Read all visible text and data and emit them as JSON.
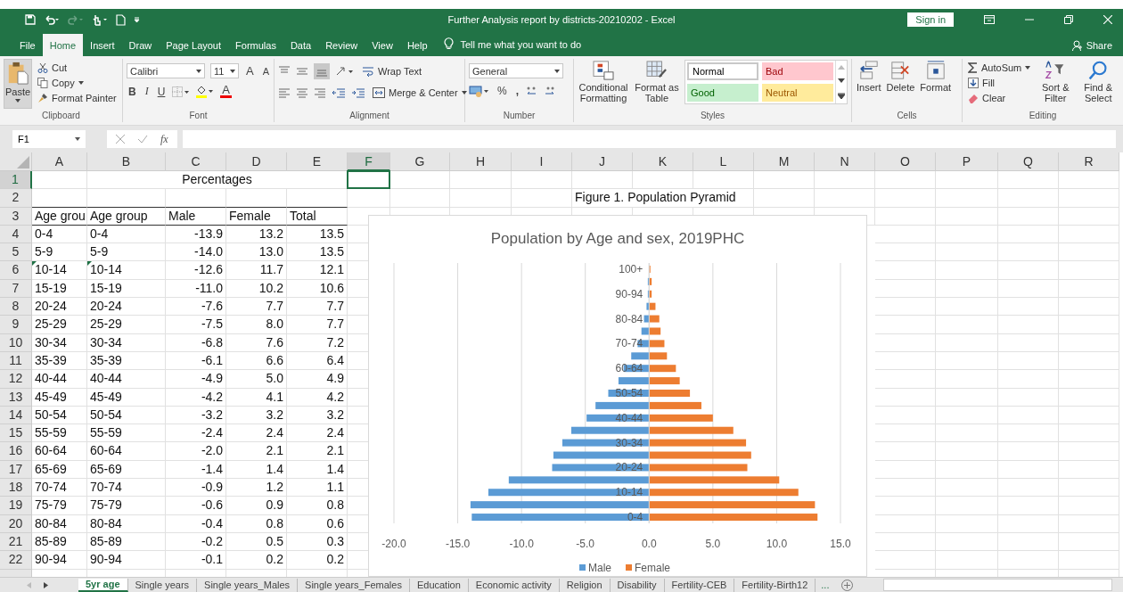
{
  "window": {
    "title": "Further Analysis report by districts-20210202 - Excel",
    "sign_in": "Sign in"
  },
  "menu_tabs": [
    {
      "label": "File",
      "selected": false
    },
    {
      "label": "Home",
      "selected": true
    },
    {
      "label": "Insert",
      "selected": false
    },
    {
      "label": "Draw",
      "selected": false
    },
    {
      "label": "Page Layout",
      "selected": false
    },
    {
      "label": "Formulas",
      "selected": false
    },
    {
      "label": "Data",
      "selected": false
    },
    {
      "label": "Review",
      "selected": false
    },
    {
      "label": "View",
      "selected": false
    },
    {
      "label": "Help",
      "selected": false
    }
  ],
  "tell_me": "Tell me what you want to do",
  "share": "Share",
  "ribbon": {
    "clipboard": {
      "paste": "Paste",
      "cut": "Cut",
      "copy": "Copy",
      "format_painter": "Format Painter",
      "label": "Clipboard"
    },
    "font": {
      "name": "Calibri",
      "size": "11",
      "grow": "A",
      "shrink": "A",
      "bold": "B",
      "italic": "I",
      "underline": "U",
      "font_color": "A",
      "label": "Font"
    },
    "alignment": {
      "wrap": "Wrap Text",
      "merge": "Merge & Center",
      "label": "Alignment"
    },
    "number": {
      "format": "General",
      "percent": "%",
      "comma": ",",
      "label": "Number"
    },
    "styles": {
      "conditional": "Conditional Formatting",
      "format_table": "Format as Table",
      "gallery": [
        {
          "label": "Normal",
          "kind": "normal"
        },
        {
          "label": "Bad",
          "kind": "bad"
        },
        {
          "label": "Good",
          "kind": "good"
        },
        {
          "label": "Neutral",
          "kind": "neutral"
        }
      ],
      "label": "Styles"
    },
    "cells": {
      "insert": "Insert",
      "delete": "Delete",
      "format": "Format",
      "label": "Cells"
    },
    "editing": {
      "autosum": "AutoSum",
      "fill": "Fill",
      "clear": "Clear",
      "sort": "Sort & Filter",
      "find": "Find & Select",
      "label": "Editing"
    }
  },
  "formula_bar": {
    "name_box": "F1",
    "fx": "fx"
  },
  "sheet": {
    "columns": [
      {
        "label": "A",
        "selected": false
      },
      {
        "label": "B",
        "selected": false
      },
      {
        "label": "C",
        "selected": false
      },
      {
        "label": "D",
        "selected": false
      },
      {
        "label": "E",
        "selected": false
      },
      {
        "label": "F",
        "selected": true
      },
      {
        "label": "G",
        "selected": false
      },
      {
        "label": "H",
        "selected": false
      },
      {
        "label": "I",
        "selected": false
      },
      {
        "label": "J",
        "selected": false
      },
      {
        "label": "K",
        "selected": false
      },
      {
        "label": "L",
        "selected": false
      },
      {
        "label": "M",
        "selected": false
      },
      {
        "label": "N",
        "selected": false
      },
      {
        "label": "O",
        "selected": false
      },
      {
        "label": "P",
        "selected": false
      },
      {
        "label": "Q",
        "selected": false
      },
      {
        "label": "R",
        "selected": false
      }
    ],
    "row_headers": [
      {
        "label": "1",
        "selected": true
      },
      {
        "label": "2",
        "selected": false
      },
      {
        "label": "3",
        "selected": false
      },
      {
        "label": "4",
        "selected": false
      },
      {
        "label": "5",
        "selected": false
      },
      {
        "label": "6",
        "selected": false
      },
      {
        "label": "7",
        "selected": false
      },
      {
        "label": "8",
        "selected": false
      },
      {
        "label": "9",
        "selected": false
      },
      {
        "label": "10",
        "selected": false
      },
      {
        "label": "11",
        "selected": false
      },
      {
        "label": "12",
        "selected": false
      },
      {
        "label": "13",
        "selected": false
      },
      {
        "label": "14",
        "selected": false
      },
      {
        "label": "15",
        "selected": false
      },
      {
        "label": "16",
        "selected": false
      },
      {
        "label": "17",
        "selected": false
      },
      {
        "label": "18",
        "selected": false
      },
      {
        "label": "19",
        "selected": false
      },
      {
        "label": "20",
        "selected": false
      },
      {
        "label": "21",
        "selected": false
      },
      {
        "label": "22",
        "selected": false
      }
    ],
    "table_title": "Percentages",
    "headers": [
      "Age grou",
      "Age group",
      "Male",
      "Female",
      "Total"
    ],
    "rows": [
      {
        "cells": [
          "0-4",
          "0-4",
          "-13.9",
          "13.2",
          "13.5"
        ],
        "flagged": false
      },
      {
        "cells": [
          "5-9",
          "5-9",
          "-14.0",
          "13.0",
          "13.5"
        ],
        "flagged": false
      },
      {
        "cells": [
          "10-14",
          "10-14",
          "-12.6",
          "11.7",
          "12.1"
        ],
        "flagged": true
      },
      {
        "cells": [
          "15-19",
          "15-19",
          "-11.0",
          "10.2",
          "10.6"
        ],
        "flagged": false
      },
      {
        "cells": [
          "20-24",
          "20-24",
          "-7.6",
          "7.7",
          "7.7"
        ],
        "flagged": false
      },
      {
        "cells": [
          "25-29",
          "25-29",
          "-7.5",
          "8.0",
          "7.7"
        ],
        "flagged": false
      },
      {
        "cells": [
          "30-34",
          "30-34",
          "-6.8",
          "7.6",
          "7.2"
        ],
        "flagged": false
      },
      {
        "cells": [
          "35-39",
          "35-39",
          "-6.1",
          "6.6",
          "6.4"
        ],
        "flagged": false
      },
      {
        "cells": [
          "40-44",
          "40-44",
          "-4.9",
          "5.0",
          "4.9"
        ],
        "flagged": false
      },
      {
        "cells": [
          "45-49",
          "45-49",
          "-4.2",
          "4.1",
          "4.2"
        ],
        "flagged": false
      },
      {
        "cells": [
          "50-54",
          "50-54",
          "-3.2",
          "3.2",
          "3.2"
        ],
        "flagged": false
      },
      {
        "cells": [
          "55-59",
          "55-59",
          "-2.4",
          "2.4",
          "2.4"
        ],
        "flagged": false
      },
      {
        "cells": [
          "60-64",
          "60-64",
          "-2.0",
          "2.1",
          "2.1"
        ],
        "flagged": false
      },
      {
        "cells": [
          "65-69",
          "65-69",
          "-1.4",
          "1.4",
          "1.4"
        ],
        "flagged": false
      },
      {
        "cells": [
          "70-74",
          "70-74",
          "-0.9",
          "1.2",
          "1.1"
        ],
        "flagged": false
      },
      {
        "cells": [
          "75-79",
          "75-79",
          "-0.6",
          "0.9",
          "0.8"
        ],
        "flagged": false
      },
      {
        "cells": [
          "80-84",
          "80-84",
          "-0.4",
          "0.8",
          "0.6"
        ],
        "flagged": false
      },
      {
        "cells": [
          "85-89",
          "85-89",
          "-0.2",
          "0.5",
          "0.3"
        ],
        "flagged": false
      },
      {
        "cells": [
          "90-94",
          "90-94",
          "-0.1",
          "0.2",
          "0.2"
        ],
        "flagged": false
      }
    ],
    "figure_caption": "Figure 1. Population Pyramid",
    "chart_data": {
      "type": "bar",
      "orientation": "horizontal",
      "title": "Population by Age and sex, 2019PHC",
      "categories": [
        "100+",
        null,
        "90-94",
        null,
        "80-84",
        null,
        "70-74",
        null,
        "60-64",
        null,
        "50-54",
        null,
        "40-44",
        null,
        "30-34",
        null,
        "20-24",
        null,
        "10-14",
        null,
        "0-4"
      ],
      "series": [
        {
          "name": "Male",
          "color": "#5b9bd5",
          "values": [
            0.0,
            -0.1,
            -0.1,
            -0.2,
            -0.4,
            -0.6,
            -0.9,
            -1.4,
            -2.0,
            -2.4,
            -3.2,
            -4.2,
            -4.9,
            -6.1,
            -6.8,
            -7.5,
            -7.6,
            -11.0,
            -12.6,
            -14.0,
            -13.9
          ]
        },
        {
          "name": "Female",
          "color": "#ed7d31",
          "values": [
            0.1,
            0.2,
            0.2,
            0.5,
            0.8,
            0.9,
            1.2,
            1.4,
            2.1,
            2.4,
            3.2,
            4.1,
            5.0,
            6.6,
            7.6,
            8.0,
            7.7,
            10.2,
            11.7,
            13.0,
            13.2
          ]
        }
      ],
      "stacked": true,
      "grid": true,
      "legend": true,
      "xlim": [
        -20,
        15
      ],
      "xticks": [
        {
          "value": -20,
          "label": "-20.0"
        },
        {
          "value": -15,
          "label": "-15.0"
        },
        {
          "value": -10,
          "label": "-10.0"
        },
        {
          "value": -5,
          "label": "-5.0"
        },
        {
          "value": 0,
          "label": "0.0"
        },
        {
          "value": 5,
          "label": "5.0"
        },
        {
          "value": 10,
          "label": "10.0"
        },
        {
          "value": 15,
          "label": "15.0"
        }
      ]
    }
  },
  "sheet_tabs": [
    {
      "label": "5yr age",
      "selected": true
    },
    {
      "label": "Single years",
      "selected": false
    },
    {
      "label": "Single years_Males",
      "selected": false
    },
    {
      "label": "Single years_Females",
      "selected": false
    },
    {
      "label": "Education",
      "selected": false
    },
    {
      "label": "Economic activity",
      "selected": false
    },
    {
      "label": "Religion",
      "selected": false
    },
    {
      "label": "Disability",
      "selected": false
    },
    {
      "label": "Fertility-CEB",
      "selected": false
    },
    {
      "label": "Fertility-Birth12",
      "selected": false
    }
  ],
  "more_tabs": "..."
}
